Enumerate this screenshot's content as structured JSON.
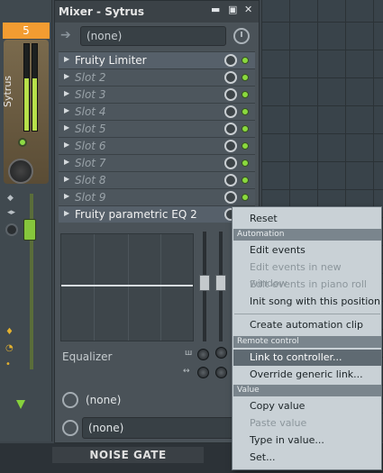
{
  "strip": {
    "number": "5",
    "name": "Sytrus"
  },
  "window": {
    "title": "Mixer - Sytrus",
    "min": "▬",
    "max": "▣",
    "close": "✕"
  },
  "preset": {
    "value": "(none)"
  },
  "slots": [
    {
      "label": "Fruity Limiter",
      "empty": false
    },
    {
      "label": "Slot 2",
      "empty": true
    },
    {
      "label": "Slot 3",
      "empty": true
    },
    {
      "label": "Slot 4",
      "empty": true
    },
    {
      "label": "Slot 5",
      "empty": true
    },
    {
      "label": "Slot 6",
      "empty": true
    },
    {
      "label": "Slot 7",
      "empty": true
    },
    {
      "label": "Slot 8",
      "empty": true
    },
    {
      "label": "Slot 9",
      "empty": true
    },
    {
      "label": "Fruity parametric EQ 2",
      "empty": false
    }
  ],
  "eq": {
    "label": "Equalizer"
  },
  "bottom": {
    "row1": "(none)",
    "row2": "(none)"
  },
  "bottom_bar": {
    "label": "NOISE GATE"
  },
  "context_menu": {
    "reset": "Reset",
    "automation_header": "Automation",
    "edit_events": "Edit events",
    "edit_events_new_window": "Edit events in new window",
    "edit_events_piano_roll": "Edit events in piano roll",
    "init_song": "Init song with this position",
    "create_automation_clip": "Create automation clip",
    "remote_header": "Remote control",
    "link_to_controller": "Link to controller...",
    "override_generic_link": "Override generic link...",
    "value_header": "Value",
    "copy_value": "Copy value",
    "paste_value": "Paste value",
    "type_in_value": "Type in value...",
    "set": "Set..."
  },
  "colors": {
    "accent_orange": "#f39c31",
    "led_green": "#8ad93e",
    "menu_bg": "#c9d1d6",
    "menu_selected": "#5f6a72"
  }
}
